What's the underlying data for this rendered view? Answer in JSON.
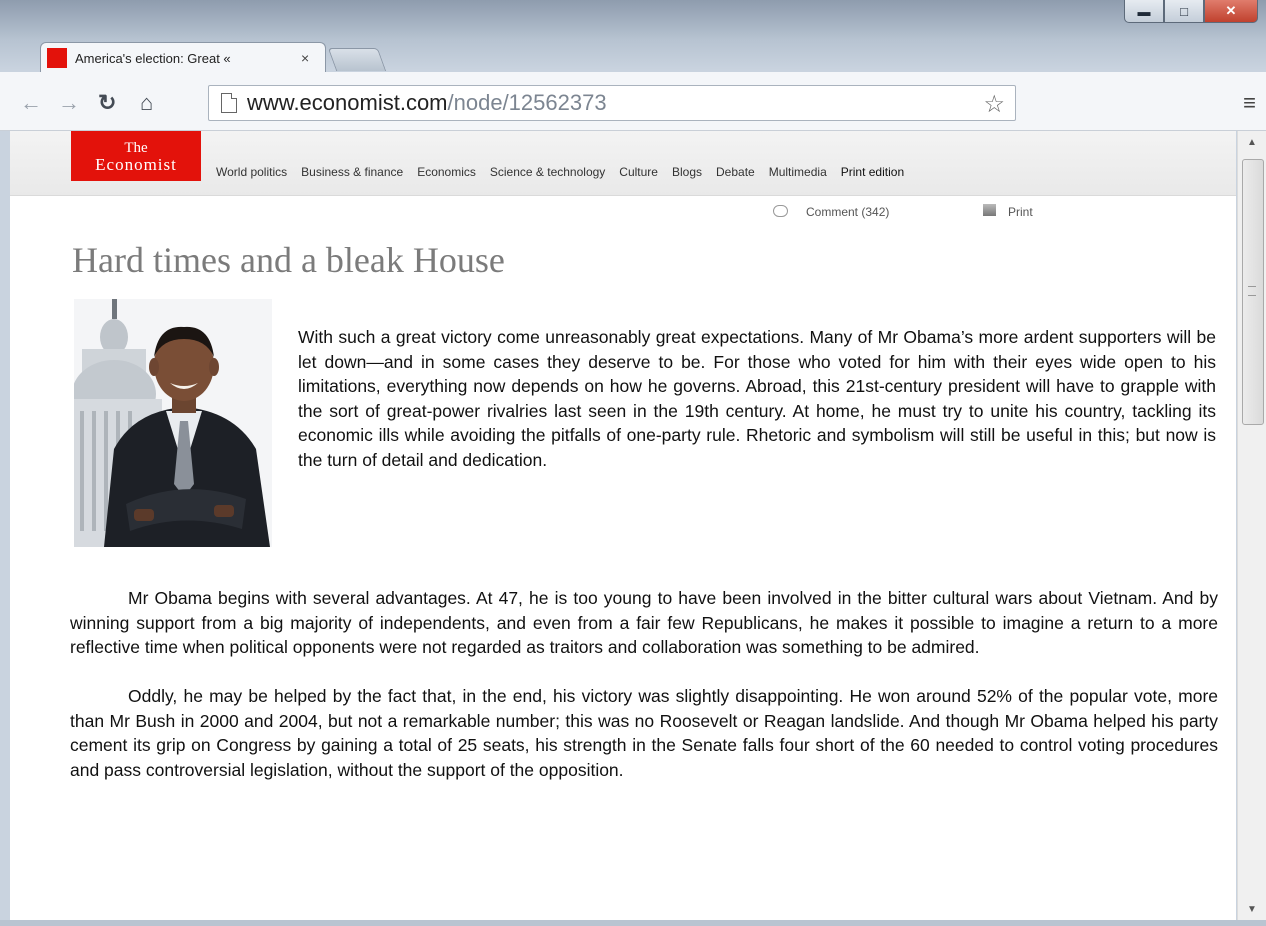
{
  "browser": {
    "tab_title": "America's election: Great «",
    "tab_close": "×",
    "url_host": "www.economist.com",
    "url_path": "/node/12562373",
    "window_controls": [
      "minimize-icon",
      "maximize-icon",
      "close-icon"
    ]
  },
  "site": {
    "logo_line1": "The",
    "logo_line2": "Economist",
    "nav": [
      "World politics",
      "Business & finance",
      "Economics",
      "Science & technology",
      "Culture",
      "Blogs",
      "Debate",
      "Multimedia",
      "Print edition"
    ],
    "comment_label": "Comment (342)",
    "print_label": "Print",
    "brand_color": "#e3120b"
  },
  "article": {
    "headline": "Hard times and a bleak House",
    "lead": "With such a great victory come unreasonably great expectations. Many of Mr Obama’s more ardent supporters will be let down—and in some cases they deserve to be. For those who voted for him with their eyes wide open to his limitations, everything now depends on how he governs. Abroad, this 21st-century president will have to grapple with the sort of great-power rivalries last seen in the 19th century. At home, he must try to unite his country, tackling its economic ills while avoiding the pitfalls of one-party rule. Rhetoric and symbolism will still be useful in this; but now is the turn of detail and dedication.",
    "paragraphs": [
      "Mr Obama begins with several advantages. At 47, he is too young to have been involved in the bitter cultural wars about Vietnam. And by winning support from a big majority of independents, and even from a fair few Republicans, he makes it possible to imagine a return to a more reflective time when political opponents were not regarded as traitors and collaboration was something to be admired.",
      "Oddly, he may be helped by the fact that, in the end, his victory was slightly disappointing. He won around 52% of the popular vote, more than Mr Bush in 2000 and 2004, but not a remarkable number; this was no Roosevelt or Reagan landslide. And though Mr Obama helped his party cement its grip on Congress by gaining a total of 25 seats, his strength in the Senate falls four short of the 60 needed to control voting procedures and pass controversial legislation, without the support of the opposition."
    ]
  }
}
